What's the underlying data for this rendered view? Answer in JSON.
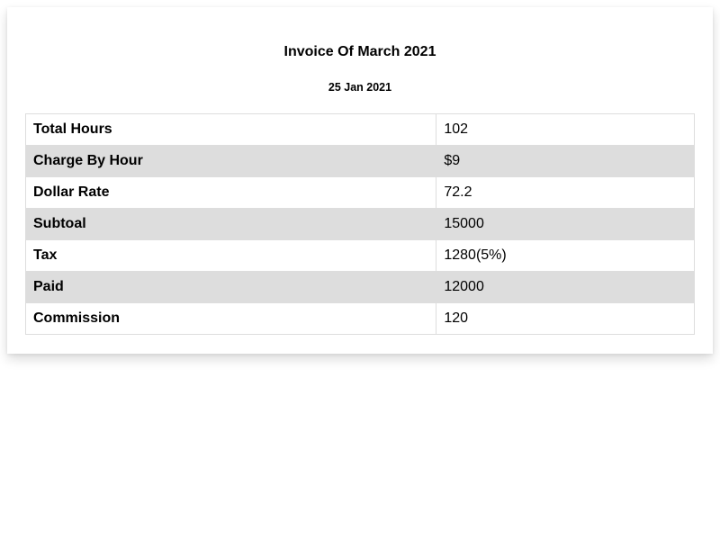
{
  "invoice": {
    "title": "Invoice Of March 2021",
    "date": "25 Jan 2021",
    "rows": [
      {
        "label": "Total Hours",
        "value": "102"
      },
      {
        "label": "Charge By Hour",
        "value": "$9"
      },
      {
        "label": "Dollar Rate",
        "value": "72.2"
      },
      {
        "label": "Subtoal",
        "value": "15000"
      },
      {
        "label": "Tax",
        "value": "1280(5%)"
      },
      {
        "label": "Paid",
        "value": "12000"
      },
      {
        "label": "Commission",
        "value": "120"
      }
    ]
  },
  "colors": {
    "striped_row_background": "#dddddd",
    "border": "#dddddd",
    "page_background": "#ffffff"
  }
}
